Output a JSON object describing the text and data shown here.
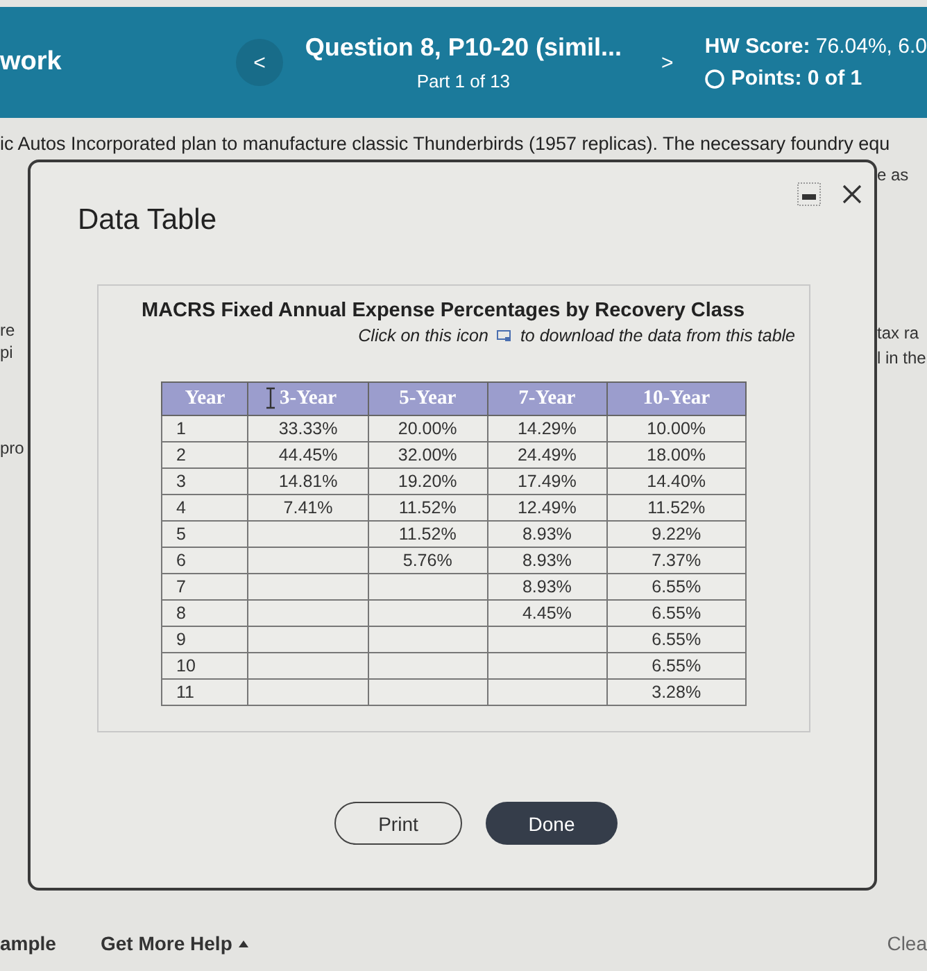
{
  "header": {
    "section": "work",
    "prev_button": "<",
    "question_title": "Question 8, P10-20 (simil...",
    "part": "Part 1 of 13",
    "next_button": ">",
    "hw_score": "**HW Score:** 76.04%, 6.0",
    "points": "Points: 0 of 1"
  },
  "question_text": "ic Autos Incorporated plan to manufacture classic Thunderbirds (1957 replicas).  The necessary foundry equ",
  "left_fragments": [
    "re",
    "pi",
    "pro"
  ],
  "right_fragments": [
    "e as",
    "tax ra",
    "l in the"
  ],
  "dialog": {
    "title": "Data Table",
    "table_title": "MACRS Fixed Annual Expense Percentages by Recovery Class",
    "download_before": "Click on this icon",
    "download_after": "to download the data from this table",
    "table": {
      "columns": [
        "Year",
        "3-Year",
        "5-Year",
        "7-Year",
        "10-Year"
      ],
      "rows": [
        [
          "1",
          "33.33%",
          "20.00%",
          "14.29%",
          "10.00%"
        ],
        [
          "2",
          "44.45%",
          "32.00%",
          "24.49%",
          "18.00%"
        ],
        [
          "3",
          "14.81%",
          "19.20%",
          "17.49%",
          "14.40%"
        ],
        [
          "4",
          "7.41%",
          "11.52%",
          "12.49%",
          "11.52%"
        ],
        [
          "5",
          null,
          "11.52%",
          "8.93%",
          "9.22%"
        ],
        [
          "6",
          null,
          "5.76%",
          "8.93%",
          "7.37%"
        ],
        [
          "7",
          null,
          null,
          "8.93%",
          "6.55%"
        ],
        [
          "8",
          null,
          null,
          "4.45%",
          "6.55%"
        ],
        [
          "9",
          null,
          null,
          null,
          "6.55%"
        ],
        [
          "10",
          null,
          null,
          null,
          "6.55%"
        ],
        [
          "11",
          null,
          null,
          null,
          "3.28%"
        ]
      ]
    },
    "buttons": [
      {
        "label": "Print",
        "kind": "secondary"
      },
      {
        "label": "Done",
        "kind": "primary"
      }
    ]
  },
  "footer": {
    "left": "ample",
    "help": "Get More Help",
    "right": "Clea"
  }
}
